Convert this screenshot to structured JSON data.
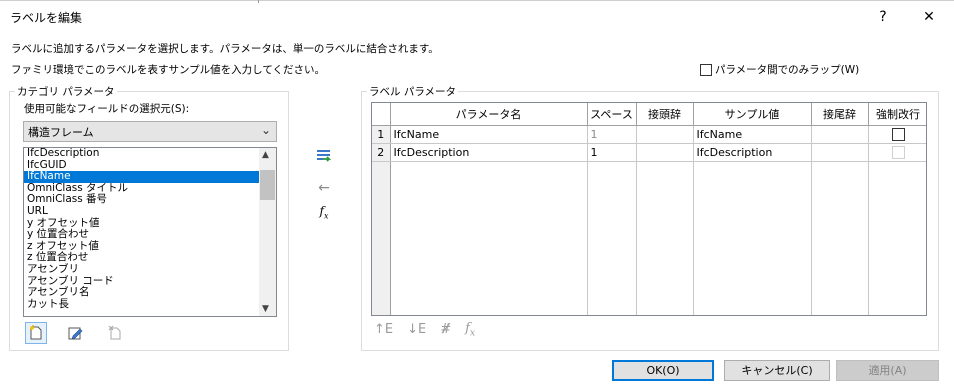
{
  "window": {
    "title": "ラベルを編集",
    "help_label": "?",
    "close_label": "✕"
  },
  "description": {
    "line1": "ラベルに追加するパラメータを選択します。パラメータは、単一のラベルに結合されます。",
    "line2": "ファミリ環境でこのラベルを表すサンプル値を入力してください。"
  },
  "wrap_option": {
    "label": "パラメータ間でのみラップ(W)",
    "checked": false
  },
  "category_group": {
    "label": "カテゴリ パラメータ",
    "select_from_label": "使用可能なフィールドの選択元(S):",
    "combo_value": "構造フレーム",
    "list_items": [
      "IfcDescription",
      "IfcGUID",
      "IfcName",
      "OmniClass タイトル",
      "OmniClass 番号",
      "URL",
      "y オフセット値",
      "y 位置合わせ",
      "z オフセット値",
      "z 位置合わせ",
      "アセンブリ",
      "アセンブリ コード",
      "アセンブリ名",
      "カット長"
    ],
    "selected_item": "IfcName"
  },
  "label_group": {
    "label": "ラベル パラメータ",
    "columns": [
      "",
      "パラメータ名",
      "スペース",
      "接頭辞",
      "サンプル値",
      "接尾辞",
      "強制改行"
    ],
    "rows": [
      {
        "num": "1",
        "name": "IfcName",
        "space": "1",
        "prefix": "",
        "sample": "IfcName",
        "suffix": "",
        "break": false
      },
      {
        "num": "2",
        "name": "IfcDescription",
        "space": "1",
        "prefix": "",
        "sample": "IfcDescription",
        "suffix": "",
        "break": false
      }
    ]
  },
  "buttons": {
    "ok": "OK(O)",
    "cancel": "キャンセル(C)",
    "apply": "適用(A)"
  },
  "icons": {
    "add_param": "add-parameter-icon",
    "remove_param": "remove-parameter-icon",
    "formula": "fx-icon",
    "new_param": "new-parameter-icon",
    "edit_param": "edit-parameter-icon",
    "delete_param": "delete-parameter-icon",
    "move_up": "move-up-icon",
    "move_down": "move-down-icon",
    "format": "format-icon",
    "formula2": "fx-icon"
  },
  "colors": {
    "selection": "#0078d7",
    "dialog_bg": "#ffffff",
    "button_bg": "#e1e1e1"
  }
}
